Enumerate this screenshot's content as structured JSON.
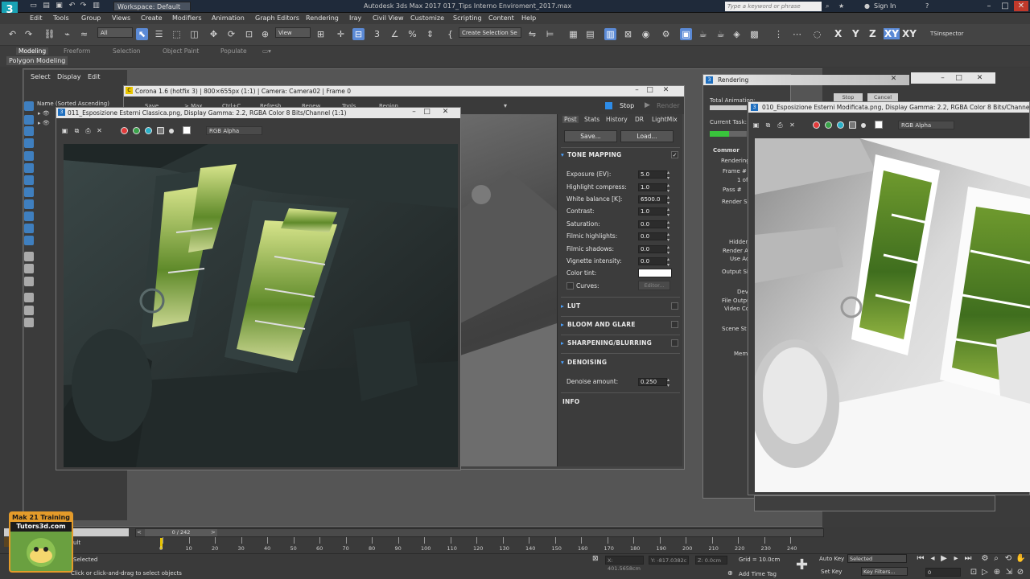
{
  "app": {
    "title": "Autodesk 3ds Max 2017   017_Tips Interno Enviroment_2017.max",
    "workspace": "Workspace: Default",
    "search_placeholder": "Type a keyword or phrase",
    "signin": "Sign In",
    "help": "?"
  },
  "menu": [
    "Edit",
    "Tools",
    "Group",
    "Views",
    "Create",
    "Modifiers",
    "Animation",
    "Graph Editors",
    "Rendering",
    "Iray",
    "Civil View",
    "Customize",
    "Scripting",
    "Content",
    "Help"
  ],
  "toolbar": {
    "filter": "All",
    "view": "View",
    "selection_set": "Create Selection Se",
    "axes": [
      "X",
      "Y",
      "Z",
      "XY",
      "XY"
    ],
    "tsinspector": "TSInspector"
  },
  "ribbon": {
    "tabs": [
      "Modeling",
      "Freeform",
      "Selection",
      "Object Paint",
      "Populate"
    ],
    "sub": "Polygon Modeling"
  },
  "explorer": {
    "menus": [
      "Select",
      "Display",
      "Edit"
    ],
    "header": "Name (Sorted Ascending)"
  },
  "corona": {
    "title": "Corona 1.6 (hotfix 3) | 800×655px (1:1) | Camera: Camera02 | Frame 0",
    "toolbar": [
      "Save",
      "> Max",
      "Ctrl+C",
      "Refresh",
      "Renew",
      "Tools",
      "Region"
    ],
    "stop": "Stop",
    "render": "Render",
    "tabs": [
      "Post",
      "Stats",
      "History",
      "DR",
      "LightMix"
    ],
    "save": "Save...",
    "load": "Load...",
    "tone_mapping": "TONE MAPPING",
    "params": [
      {
        "label": "Exposure (EV):",
        "value": "5.0"
      },
      {
        "label": "Highlight compress:",
        "value": "1.0"
      },
      {
        "label": "White balance [K]:",
        "value": "6500.0"
      },
      {
        "label": "Contrast:",
        "value": "1.0"
      },
      {
        "label": "Saturation:",
        "value": "0.0"
      },
      {
        "label": "Filmic highlights:",
        "value": "0.0"
      },
      {
        "label": "Filmic shadows:",
        "value": "0.0"
      },
      {
        "label": "Vignette intensity:",
        "value": "0.0"
      }
    ],
    "color_tint": "Color tint:",
    "curves": "Curves:",
    "curves_btn": "Editor...",
    "lut": "LUT",
    "bloom": "BLOOM AND GLARE",
    "sharpen": "SHARPENING/BLURRING",
    "denoise": "DENOISING",
    "denoise_label": "Denoise amount:",
    "denoise_value": "0.250",
    "info": "INFO"
  },
  "vfb_left": {
    "title": "011_Esposizione Esterni Classica.png, Display Gamma: 2.2, RGBA Color 8 Bits/Channel (1:1)",
    "channel": "RGB Alpha"
  },
  "vfb_right": {
    "title": "010_Esposizione Esterni Modificata.png, Display Gamma: 2.2, RGBA Color 8 Bits/Channel (1:1)",
    "channel": "RGB Alpha"
  },
  "rendering": {
    "title": "Rendering",
    "total_animation": "Total Animation:",
    "current_task": "Current Task:",
    "stop": "Stop",
    "cancel": "Cancel",
    "common": "Commor",
    "labels": [
      "Rendering",
      "Frame #",
      "1 of",
      "Pass #",
      "Render Se",
      "Hidden",
      "Render A",
      "Use Ac",
      "Output Si",
      "Dev",
      "File Outpu",
      "Video Co",
      "Scene St",
      "Mem"
    ]
  },
  "timeline": {
    "frame": "0 / 242",
    "ticks": [
      "0",
      "10",
      "20",
      "30",
      "40",
      "50",
      "60",
      "70",
      "80",
      "90",
      "100",
      "110",
      "120",
      "130",
      "140",
      "150",
      "160",
      "170",
      "180",
      "190",
      "200",
      "210",
      "220",
      "230",
      "240"
    ]
  },
  "status": {
    "selected": "Selected",
    "hint": "Click or click-and-drag to select objects",
    "x": "X: 401.5658cm",
    "y": "Y: -817.0382c",
    "z": "Z: 0.0cm",
    "grid": "Grid = 10.0cm",
    "add_time_tag": "Add Time Tag",
    "auto_key": "Auto Key",
    "set_key": "Set Key",
    "sel_drop": "Selected",
    "key_filters": "Key Filters...",
    "frame_box": "0",
    "max_label": "ult"
  },
  "watermark": {
    "line1": "Mak 21 Training",
    "line2": "Tutors3d.com"
  },
  "colors": {
    "accent": "#4da3ff",
    "title_bg": "#1f2a3a",
    "window_title": "#e7e7e7"
  }
}
